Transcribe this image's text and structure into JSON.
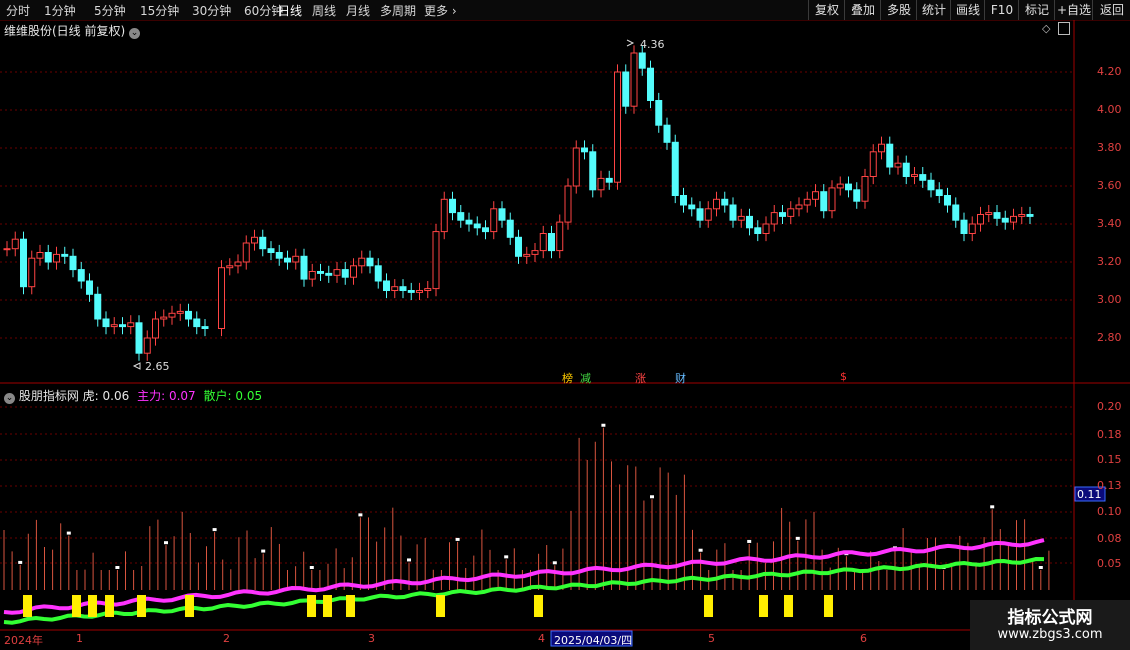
{
  "toolbar": {
    "periods": [
      "分时",
      "1分钟",
      "5分钟",
      "15分钟",
      "30分钟",
      "60分钟",
      "日线",
      "周线",
      "月线",
      "多周期"
    ],
    "more": "更多",
    "active_index": 6,
    "right_buttons": [
      "复权",
      "叠加",
      "多股",
      "统计",
      "画线",
      "F10",
      "标记",
      "+自选",
      "返回"
    ]
  },
  "main_chart": {
    "title": "维维股份(日线 前复权)",
    "high_label": "4.36",
    "low_label": "2.65",
    "y_ticks": [
      "4.20",
      "4.00",
      "3.80",
      "3.60",
      "3.40",
      "3.20",
      "3.00",
      "2.80"
    ],
    "markers": [
      {
        "text": "榜",
        "color": "#ffcc00"
      },
      {
        "text": "减",
        "color": "#44dd44"
      },
      {
        "text": "涨",
        "color": "#ff4444"
      },
      {
        "text": "财",
        "color": "#66bbff"
      },
      {
        "text": "$",
        "color": "#ff3333"
      }
    ],
    "up_color": "#ff4444",
    "down_color": "#54fcfc"
  },
  "indicator": {
    "name": "股朋指标网",
    "tiger_label": "虎:",
    "tiger_value": "0.06",
    "main_label": "主力:",
    "main_value": "0.07",
    "retail_label": "散户:",
    "retail_value": "0.05",
    "main_color": "#ff33ff",
    "retail_color": "#33ff33",
    "y_ticks": [
      "0.20",
      "0.18",
      "0.15",
      "0.13",
      "0.10",
      "0.08",
      "0.05"
    ],
    "current_value": "0.11"
  },
  "x_axis": {
    "year_label": "2024年",
    "months": [
      "1",
      "2",
      "3",
      "4",
      "5",
      "6"
    ],
    "cursor_date": "2025/04/03/四"
  },
  "watermark": {
    "line1": "指标公式网",
    "line2": "www.zbgs3.com"
  }
}
